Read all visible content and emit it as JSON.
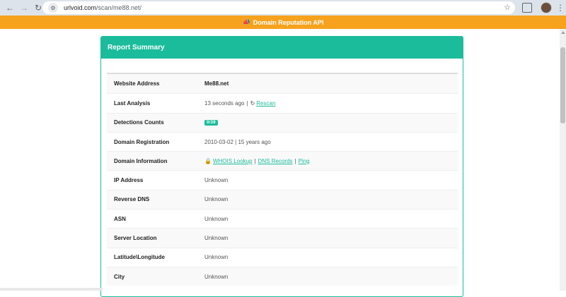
{
  "browser": {
    "url_host": "urlvoid.com",
    "url_path": "/scan/me88.net/",
    "back_icon": "arrow-left",
    "forward_icon": "arrow-right",
    "reload_icon": "reload",
    "bookmark_icon": "star-outline"
  },
  "banner": {
    "icon": "megaphone",
    "label": "Domain Reputation API",
    "color": "#f6a21c"
  },
  "panel": {
    "title": "Report Summary",
    "accent": "#1abc9c"
  },
  "rows": {
    "website": {
      "label": "Website Address",
      "value": "Me88.net"
    },
    "last_analysis": {
      "label": "Last Analysis",
      "value": "13 seconds ago",
      "separator": "|",
      "rescan": "Rescan"
    },
    "detections": {
      "label": "Detections Counts",
      "badge": "0/39"
    },
    "registration": {
      "label": "Domain Registration",
      "value": "2010-03-02 | 15 years ago"
    },
    "domain_info": {
      "label": "Domain Information",
      "whois": "WHOIS Lookup",
      "sep1": "|",
      "dns": "DNS Records",
      "sep2": "|",
      "ping": "Ping"
    },
    "ip": {
      "label": "IP Address",
      "value": "Unknown"
    },
    "reverse_dns": {
      "label": "Reverse DNS",
      "value": "Unknown"
    },
    "asn": {
      "label": "ASN",
      "value": "Unknown"
    },
    "server_location": {
      "label": "Server Location",
      "value": "Unknown"
    },
    "lat_long": {
      "label": "Latitude\\Longitude",
      "value": "Unknown"
    },
    "city": {
      "label": "City",
      "value": "Unknown"
    }
  }
}
